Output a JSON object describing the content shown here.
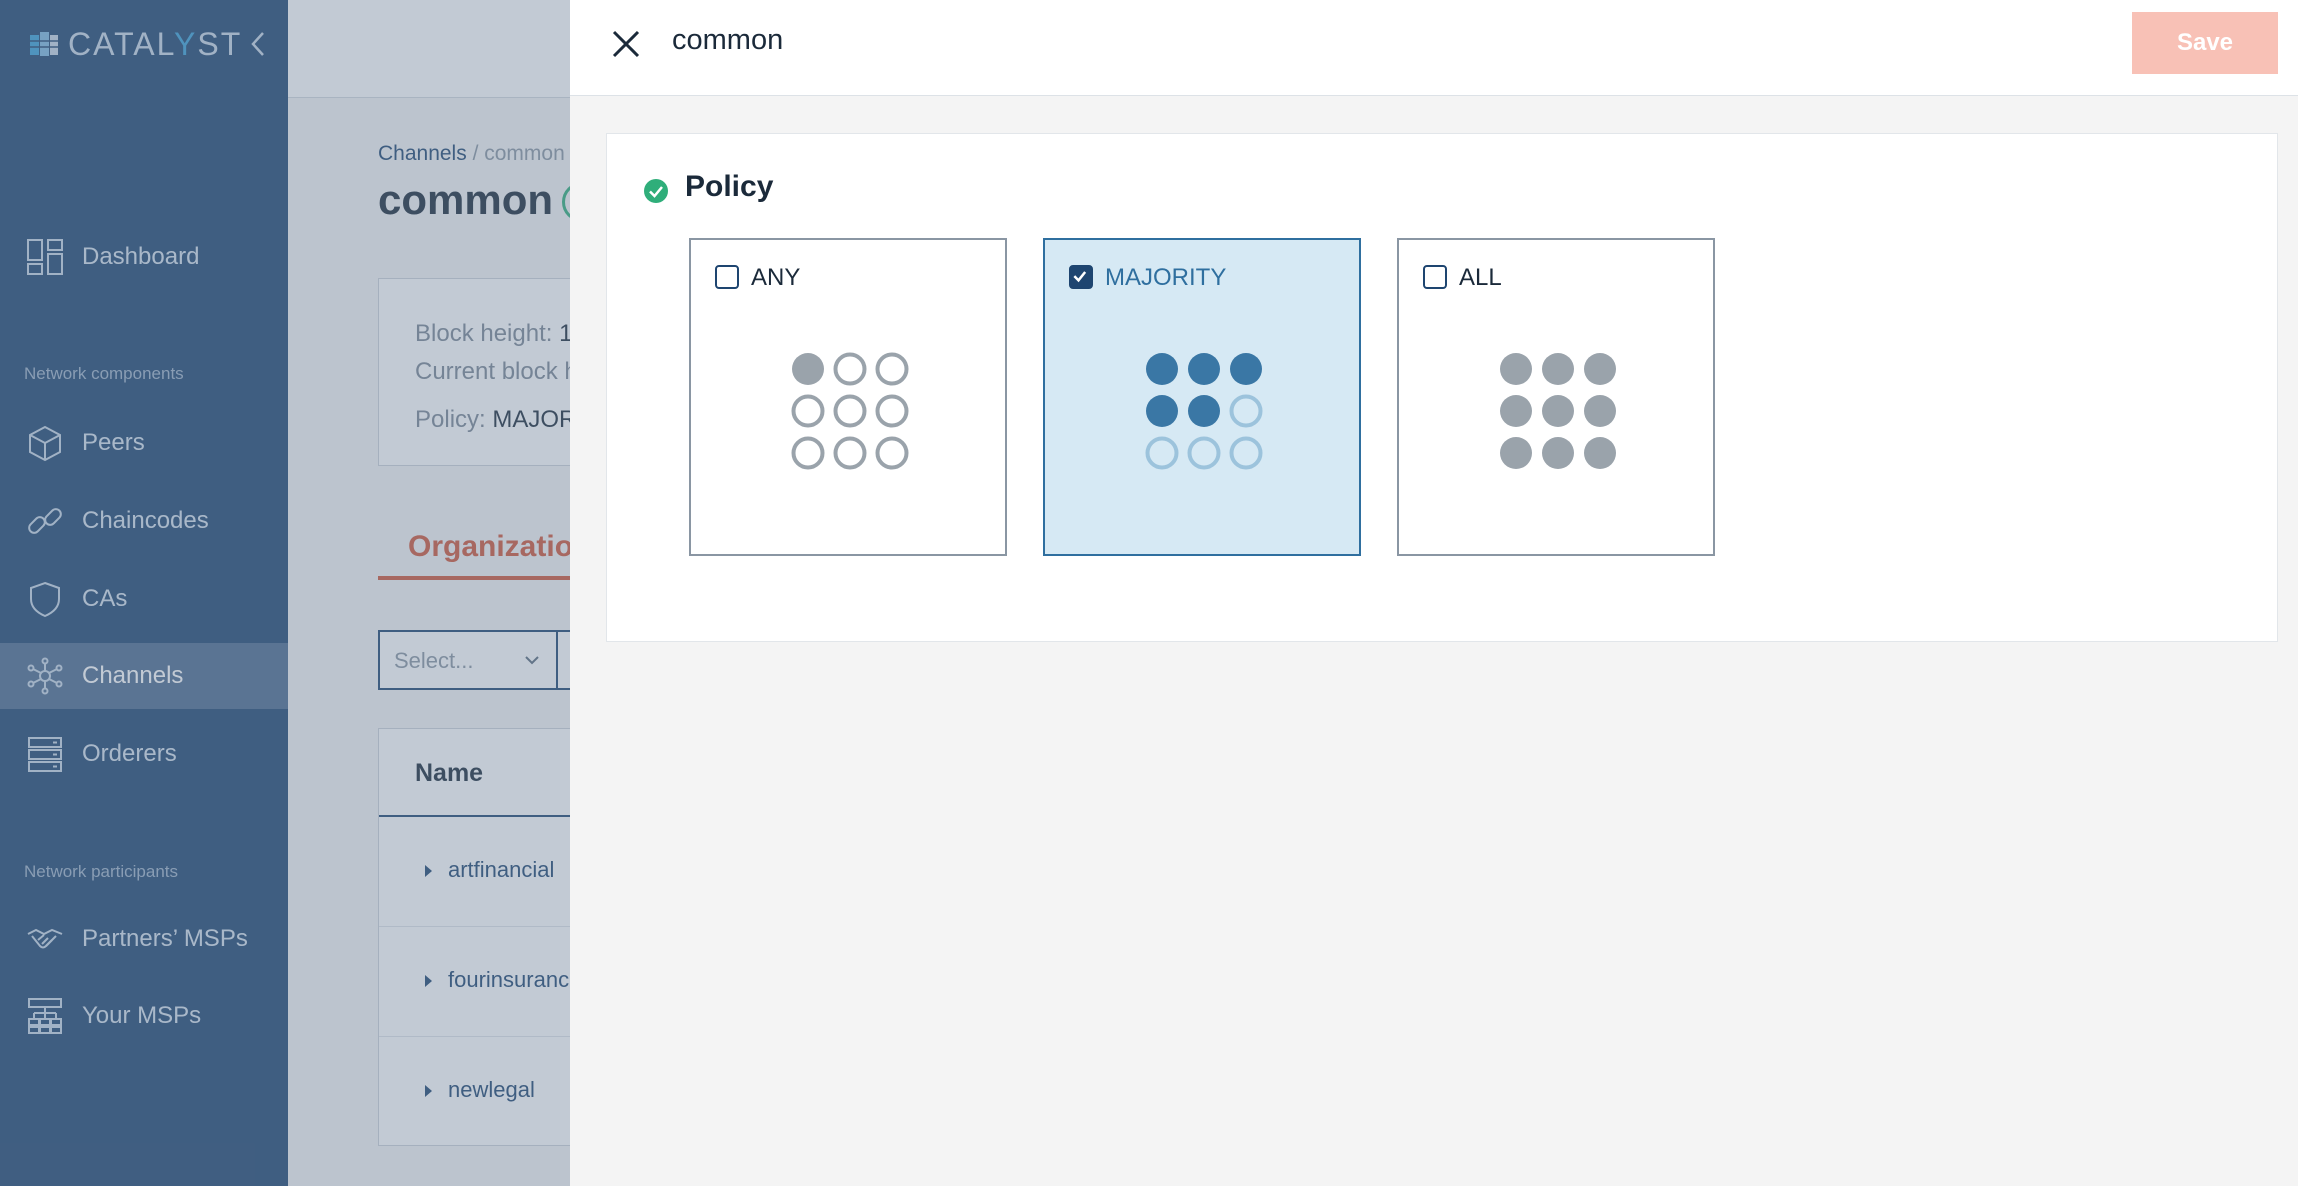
{
  "sidebar": {
    "brand": {
      "prefix": "CATAL",
      "accent": "Y",
      "suffix": "ST"
    },
    "items": [
      {
        "label": "Dashboard",
        "icon": "dashboard-icon"
      },
      {
        "label": "Peers",
        "icon": "cube-icon"
      },
      {
        "label": "Chaincodes",
        "icon": "link-icon"
      },
      {
        "label": "CAs",
        "icon": "shield-icon"
      },
      {
        "label": "Channels",
        "icon": "network-icon",
        "active": true
      },
      {
        "label": "Orderers",
        "icon": "server-icon"
      },
      {
        "label": "Partners’ MSPs",
        "icon": "handshake-icon"
      },
      {
        "label": "Your MSPs",
        "icon": "org-chart-icon"
      }
    ],
    "sections": {
      "components": "Network components",
      "participants": "Network participants"
    }
  },
  "background_page": {
    "breadcrumb": {
      "link": "Channels",
      "separator": " / ",
      "current": "common"
    },
    "title": "common",
    "info": {
      "block_height_label": "Block height:",
      "block_height_value": "1",
      "current_block_label": "Current block h",
      "policy_label": "Policy:",
      "policy_value": "MAJOR"
    },
    "tab": "Organization",
    "select_placeholder": "Select...",
    "table": {
      "header": "Name",
      "rows": [
        "artfinancial",
        "fourinsurance",
        "newlegal"
      ]
    }
  },
  "panel": {
    "title": "common",
    "save_label": "Save",
    "card_title": "Policy",
    "options": [
      {
        "label": "ANY",
        "checked": false
      },
      {
        "label": "MAJORITY",
        "checked": true
      },
      {
        "label": "ALL",
        "checked": false
      }
    ]
  },
  "colors": {
    "sidebar_bg": "#1e4570",
    "active_nav": "#4c6b8f",
    "accent_red": "#d0563a",
    "save_disabled": "#f8c1b6",
    "selected_bg": "#d6e9f4",
    "selected_border": "#2f6f9f",
    "success_green": "#2fae7a"
  }
}
